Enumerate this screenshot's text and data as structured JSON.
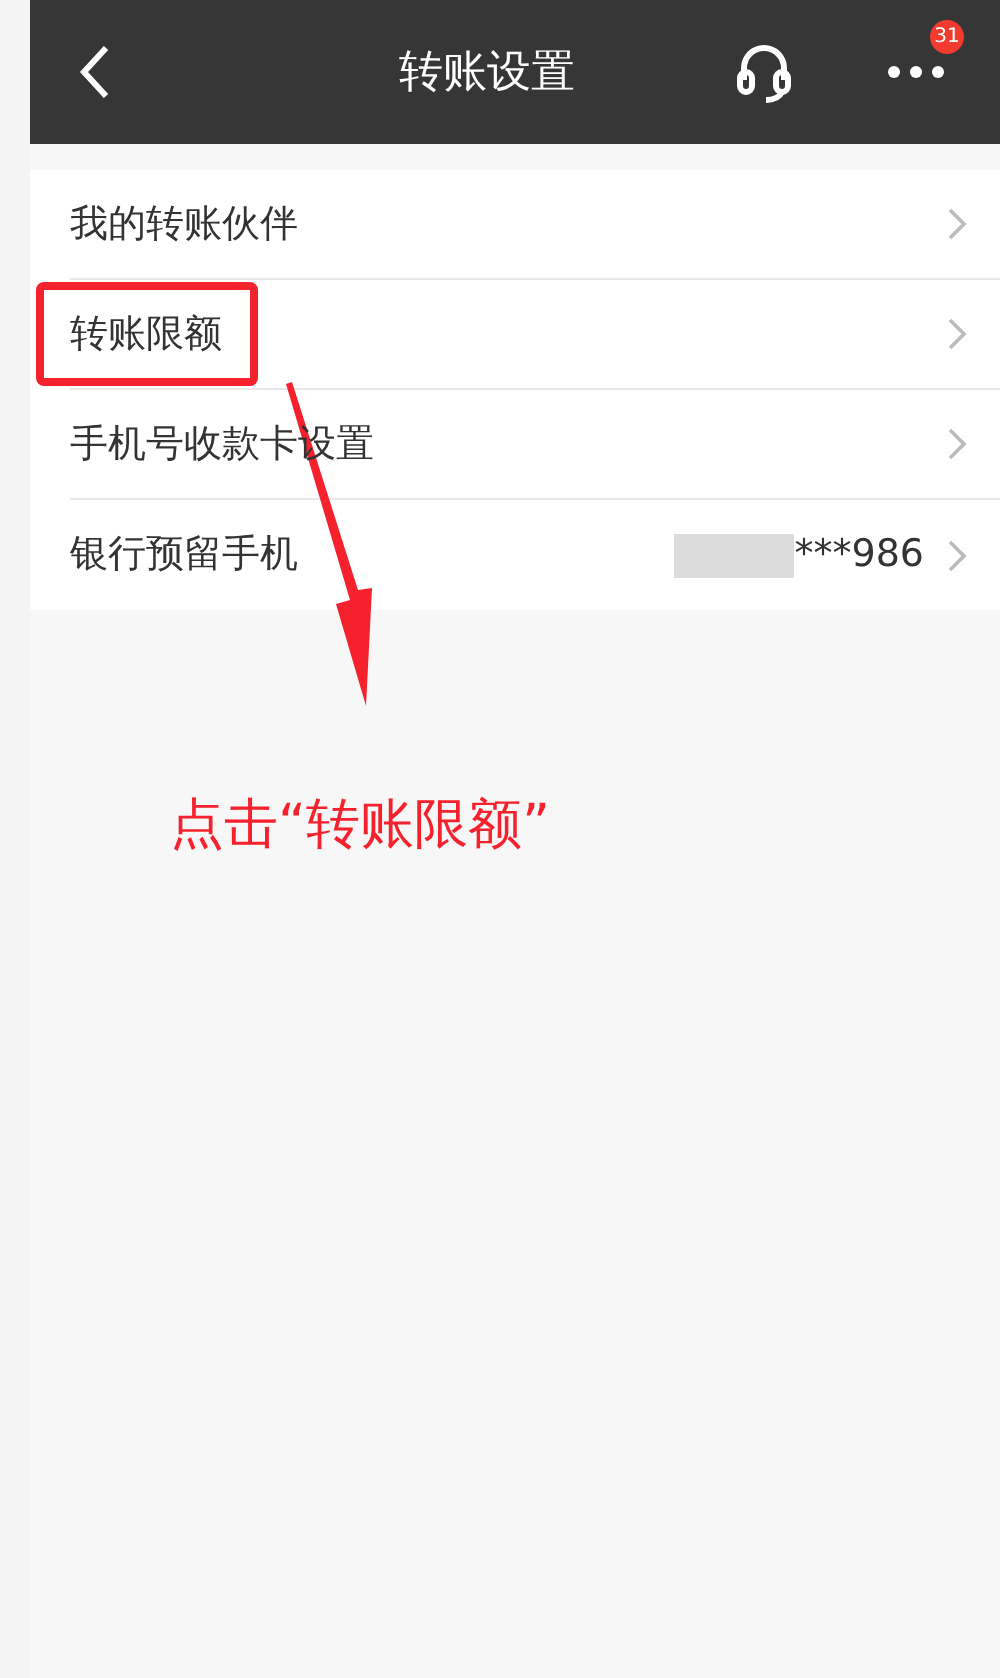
{
  "header": {
    "title": "转账设置",
    "badge": "31"
  },
  "items": [
    {
      "label": "我的转账伙伴",
      "highlighted": false
    },
    {
      "label": "转账限额",
      "highlighted": true
    },
    {
      "label": "手机号收款卡设置",
      "highlighted": false
    },
    {
      "label": "银行预留手机",
      "value": "***986",
      "masked": true,
      "highlighted": false
    }
  ],
  "annotation": {
    "text": "点击“转账限额”"
  }
}
